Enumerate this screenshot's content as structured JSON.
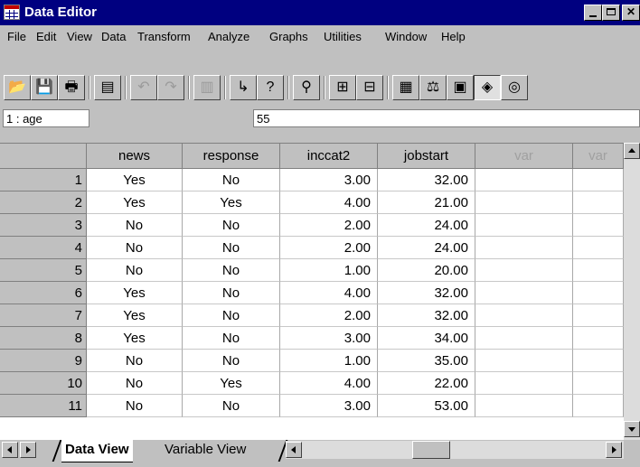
{
  "window": {
    "title": "Data Editor"
  },
  "menu": [
    "File",
    "Edit",
    "View",
    "Data",
    "Transform",
    "Analyze",
    "Graphs",
    "Utilities",
    "Window",
    "Help"
  ],
  "toolbar": {
    "icons": [
      "open-file-icon",
      "save-icon",
      "print-icon",
      "dialog-recall-icon",
      "undo-icon",
      "redo-icon",
      "goto-chart-icon",
      "goto-case-icon",
      "variables-icon",
      "find-icon",
      "insert-case-icon",
      "insert-variable-icon",
      "split-file-icon",
      "weight-cases-icon",
      "select-cases-icon",
      "value-labels-icon",
      "use-sets-icon"
    ]
  },
  "cell_info": {
    "ref": "1 : age",
    "value": "55"
  },
  "grid": {
    "columns": [
      "news",
      "response",
      "inccat2",
      "jobstart",
      "var",
      "var"
    ],
    "rows": [
      [
        "1",
        "Yes",
        "No",
        "3.00",
        "32.00"
      ],
      [
        "2",
        "Yes",
        "Yes",
        "4.00",
        "21.00"
      ],
      [
        "3",
        "No",
        "No",
        "2.00",
        "24.00"
      ],
      [
        "4",
        "No",
        "No",
        "2.00",
        "24.00"
      ],
      [
        "5",
        "No",
        "No",
        "1.00",
        "20.00"
      ],
      [
        "6",
        "Yes",
        "No",
        "4.00",
        "32.00"
      ],
      [
        "7",
        "Yes",
        "No",
        "2.00",
        "32.00"
      ],
      [
        "8",
        "Yes",
        "No",
        "3.00",
        "34.00"
      ],
      [
        "9",
        "No",
        "No",
        "1.00",
        "35.00"
      ],
      [
        "10",
        "No",
        "Yes",
        "4.00",
        "22.00"
      ],
      [
        "11",
        "No",
        "No",
        "3.00",
        "53.00"
      ]
    ]
  },
  "tabs": {
    "data_view": "Data View",
    "variable_view": "Variable View"
  }
}
